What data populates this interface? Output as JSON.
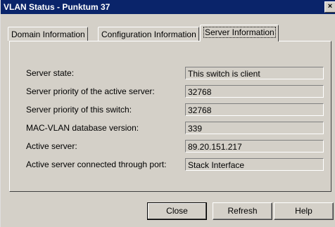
{
  "window": {
    "title": "VLAN Status - Punktum 37",
    "close_glyph": "×"
  },
  "tabs": [
    {
      "label": "Domain Information",
      "active": false
    },
    {
      "label": "Configuration Information",
      "active": false
    },
    {
      "label": "Server Information",
      "active": true
    }
  ],
  "server_info": {
    "rows": [
      {
        "label": "Server state:",
        "value": "This switch is client"
      },
      {
        "label": "Server priority of the active server:",
        "value": "32768"
      },
      {
        "label": "Server priority of this switch:",
        "value": "32768"
      },
      {
        "label": "MAC-VLAN database version:",
        "value": "339"
      },
      {
        "label": "Active server:",
        "value": "89.20.151.217"
      },
      {
        "label": "Active server connected through port:",
        "value": "Stack Interface"
      }
    ]
  },
  "buttons": {
    "close": "Close",
    "refresh": "Refresh",
    "help": "Help"
  },
  "colors": {
    "titlebar": "#0a246a",
    "face": "#d4d0c8"
  }
}
